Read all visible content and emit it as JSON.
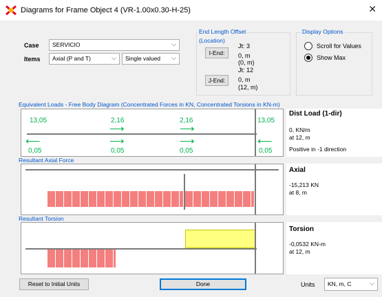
{
  "window": {
    "title": "Diagrams for Frame Object 4  (VR-1.00x0.30-H-25)"
  },
  "case_group": {
    "case_label": "Case",
    "case_value": "SERVICIO",
    "items_label": "Items",
    "items_value": "Axial (P and T)",
    "mode_value": "Single valued"
  },
  "end_length": {
    "title": "End Length Offset",
    "subtitle": "(Location)",
    "i_end_button": "I-End:",
    "i_jt": "Jt:  3",
    "i_offset": "0, m",
    "i_location": "(0, m)",
    "j_end_button": "J-End:",
    "j_jt": "Jt:  12",
    "j_offset": "0, m",
    "j_location": "(12, m)"
  },
  "display_options": {
    "title": "Display Options",
    "options": [
      {
        "label": "Scroll for Values",
        "checked": false
      },
      {
        "label": "Show Max",
        "checked": true
      }
    ]
  },
  "loads_panel": {
    "header": "Equivalent Loads - Free Body Diagram  (Concentrated Forces in KN, Concentrated Torsions in KN-m)",
    "top_values": [
      "13,05",
      "2,16",
      "2,16",
      "13,05"
    ],
    "bottom_values": [
      "0,05",
      "0,05",
      "0,05",
      "0,05"
    ],
    "side_title": "Dist Load (1-dir)",
    "side_value": "0, KN/m",
    "side_location": "at 12, m",
    "side_note": "Positive in -1 direction",
    "color": "#00b34d"
  },
  "axial_panel": {
    "header": "Resultant Axial Force",
    "side_title": "Axial",
    "side_value": "-15,213 KN",
    "side_location": "at 8, m",
    "color": "#f47f7f"
  },
  "torsion_panel": {
    "header": "Resultant Torsion",
    "side_title": "Torsion",
    "side_value": "-0,0532 KN-m",
    "side_location": "at 12, m",
    "negative_color": "#f47f7f",
    "positive_color": "#ffff80"
  },
  "footer": {
    "reset_button": "Reset to Initial Units",
    "done_button": "Done",
    "units_label": "Units",
    "units_value": "KN, m, C"
  },
  "icons": [
    "sap-app-icon",
    "close-icon",
    "chevron-down-icon",
    "arrow-right-icon",
    "arrow-left-icon"
  ]
}
